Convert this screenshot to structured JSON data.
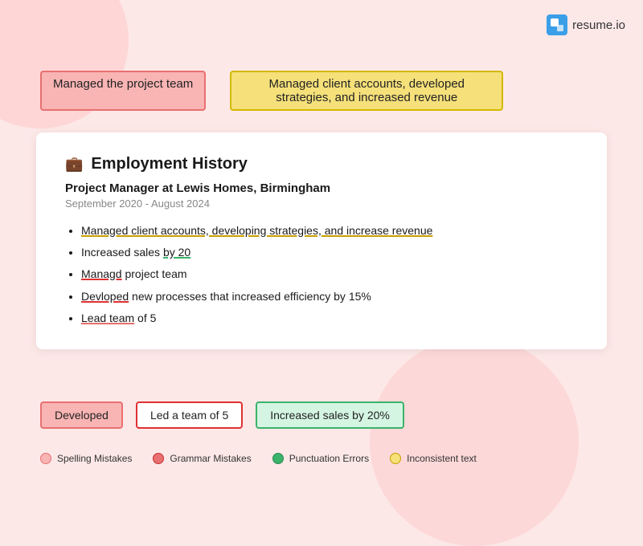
{
  "logo": {
    "text": "resume.io"
  },
  "top_tags": {
    "pink_tag": "Managed the project team",
    "yellow_tag": "Managed client accounts, developed strategies, and increased revenue"
  },
  "resume": {
    "section_title": "Employment History",
    "job_title": "Project Manager at Lewis Homes, Birmingham",
    "dates": "September 2020 - August 2024",
    "bullets": [
      {
        "id": 1,
        "text_before": "",
        "underline_yellow": "Managed client accounts, developing strategies, and increase revenue",
        "text_after": ""
      },
      {
        "id": 2,
        "text_before": "Increased sales ",
        "underline_green": "by 20",
        "text_after": ""
      },
      {
        "id": 3,
        "text_before": "",
        "underline_red": "Managd",
        "text_after": " project team"
      },
      {
        "id": 4,
        "text_before": "",
        "underline_red": "Devloped",
        "text_after": " new processes that increased efficiency by 15%"
      },
      {
        "id": 5,
        "text_before": "",
        "underline_pink": "Lead team",
        "text_after": " of 5"
      }
    ]
  },
  "bottom_tags": {
    "tag1": "Developed",
    "tag2": "Led a team of 5",
    "tag3": "Increased sales by 20%"
  },
  "legend": {
    "item1": "Spelling Mistakes",
    "item2": "Grammar Mistakes",
    "item3": "Punctuation Errors",
    "item4": "Inconsistent text"
  }
}
